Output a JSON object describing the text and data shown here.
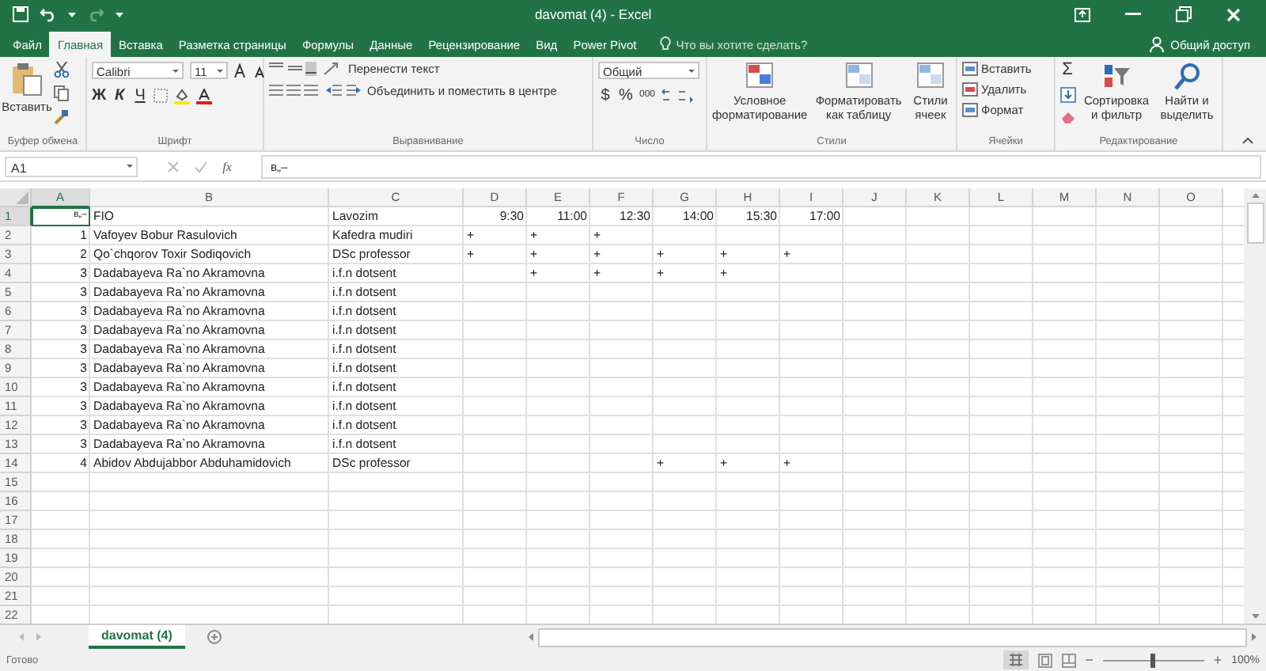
{
  "window": {
    "title": "davomat (4) - Excel"
  },
  "tabs": [
    {
      "label": "Файл",
      "selected": false
    },
    {
      "label": "Главная",
      "selected": true
    },
    {
      "label": "Вставка",
      "selected": false
    },
    {
      "label": "Разметка страницы",
      "selected": false
    },
    {
      "label": "Формулы",
      "selected": false
    },
    {
      "label": "Данные",
      "selected": false
    },
    {
      "label": "Рецензирование",
      "selected": false
    },
    {
      "label": "Вид",
      "selected": false
    },
    {
      "label": "Power Pivot",
      "selected": false
    }
  ],
  "tell_me": {
    "placeholder": "Что вы хотите сделать?"
  },
  "share": "Общий доступ",
  "ribbon": {
    "groups": [
      {
        "kind": "clipboard",
        "label": "Буфер обмена",
        "paste": "Вставить"
      },
      {
        "kind": "font",
        "label": "Шрифт",
        "font": "Calibri",
        "size": "11",
        "bold": "Ж",
        "italic": "К",
        "underline": "Ч"
      },
      {
        "kind": "alignment",
        "label": "Выравнивание",
        "wrap": "Перенести текст",
        "merge": "Объединить и поместить в центре"
      },
      {
        "kind": "number",
        "label": "Число",
        "format": "Общий",
        "currency": "$",
        "percent": "%",
        "thousands": "000"
      },
      {
        "kind": "styles",
        "label": "Стили",
        "buttons": [
          "Условное форматирование",
          "Форматировать как таблицу",
          "Стили ячеек"
        ]
      },
      {
        "kind": "cells",
        "label": "Ячейки",
        "buttons": [
          "Вставить",
          "Удалить",
          "Формат"
        ]
      },
      {
        "kind": "editing",
        "label": "Редактирование",
        "sum": "Σ",
        "buttons": [
          "Сортировка и фильтр",
          "Найти и выделить"
        ]
      }
    ]
  },
  "formula_bar": {
    "name_box": "A1",
    "function": "fx",
    "value": "в„–"
  },
  "sheet": {
    "columns": [
      {
        "label": "A",
        "selected": true
      },
      {
        "label": "B",
        "selected": false
      },
      {
        "label": "C",
        "selected": false
      },
      {
        "label": "D",
        "selected": false
      },
      {
        "label": "E",
        "selected": false
      },
      {
        "label": "F",
        "selected": false
      },
      {
        "label": "G",
        "selected": false
      },
      {
        "label": "H",
        "selected": false
      },
      {
        "label": "I",
        "selected": false
      },
      {
        "label": "J",
        "selected": false
      },
      {
        "label": "K",
        "selected": false
      },
      {
        "label": "L",
        "selected": false
      },
      {
        "label": "M",
        "selected": false
      },
      {
        "label": "N",
        "selected": false
      },
      {
        "label": "O",
        "selected": false
      }
    ],
    "rows": [
      {
        "header": "1",
        "selected": true,
        "a": "в„–",
        "b": "FIO",
        "c": "Lavozim",
        "d": "9:30",
        "e": "11:00",
        "f": "12:30",
        "g": "14:00",
        "h": "15:30",
        "i": "17:00"
      },
      {
        "header": "2",
        "selected": false,
        "a": "1",
        "b": "Vafoyev Bobur Rasulovich",
        "c": "Kafedra mudiri",
        "d": "+",
        "e": "+",
        "f": "+"
      },
      {
        "header": "3",
        "selected": false,
        "a": "2",
        "b": "Qo`chqorov Toxir Sodiqovich",
        "c": "DSc professor",
        "d": "+",
        "e": "+",
        "f": "+",
        "g": "+",
        "h": "+",
        "i": "+"
      },
      {
        "header": "4",
        "selected": false,
        "a": "3",
        "b": "Dadabayeva Ra`no Akramovna",
        "c": "i.f.n dotsent",
        "e": "+",
        "f": "+",
        "g": "+",
        "h": "+"
      },
      {
        "header": "5",
        "selected": false,
        "a": "3",
        "b": "Dadabayeva Ra`no Akramovna",
        "c": "i.f.n dotsent"
      },
      {
        "header": "6",
        "selected": false,
        "a": "3",
        "b": "Dadabayeva Ra`no Akramovna",
        "c": "i.f.n dotsent"
      },
      {
        "header": "7",
        "selected": false,
        "a": "3",
        "b": "Dadabayeva Ra`no Akramovna",
        "c": "i.f.n dotsent"
      },
      {
        "header": "8",
        "selected": false,
        "a": "3",
        "b": "Dadabayeva Ra`no Akramovna",
        "c": "i.f.n dotsent"
      },
      {
        "header": "9",
        "selected": false,
        "a": "3",
        "b": "Dadabayeva Ra`no Akramovna",
        "c": "i.f.n dotsent"
      },
      {
        "header": "10",
        "selected": false,
        "a": "3",
        "b": "Dadabayeva Ra`no Akramovna",
        "c": "i.f.n dotsent"
      },
      {
        "header": "11",
        "selected": false,
        "a": "3",
        "b": "Dadabayeva Ra`no Akramovna",
        "c": "i.f.n dotsent"
      },
      {
        "header": "12",
        "selected": false,
        "a": "3",
        "b": "Dadabayeva Ra`no Akramovna",
        "c": "i.f.n dotsent"
      },
      {
        "header": "13",
        "selected": false,
        "a": "3",
        "b": "Dadabayeva Ra`no Akramovna",
        "c": "i.f.n dotsent"
      },
      {
        "header": "14",
        "selected": false,
        "a": "4",
        "b": "Abidov Abdujabbor Abduhamidovich",
        "c": "DSc professor",
        "g": "+",
        "h": "+",
        "i": "+"
      },
      {
        "header": "15",
        "selected": false
      },
      {
        "header": "16",
        "selected": false
      },
      {
        "header": "17",
        "selected": false
      },
      {
        "header": "18",
        "selected": false
      },
      {
        "header": "19",
        "selected": false
      },
      {
        "header": "20",
        "selected": false
      },
      {
        "header": "21",
        "selected": false
      },
      {
        "header": "22",
        "selected": false
      }
    ]
  },
  "sheet_tabs": [
    {
      "label": "davomat (4)",
      "selected": true
    }
  ],
  "status_bar": {
    "text": "Готово",
    "zoom": {
      "minus": "−",
      "plus": "+",
      "level": 0.5,
      "reading": "100%"
    }
  }
}
